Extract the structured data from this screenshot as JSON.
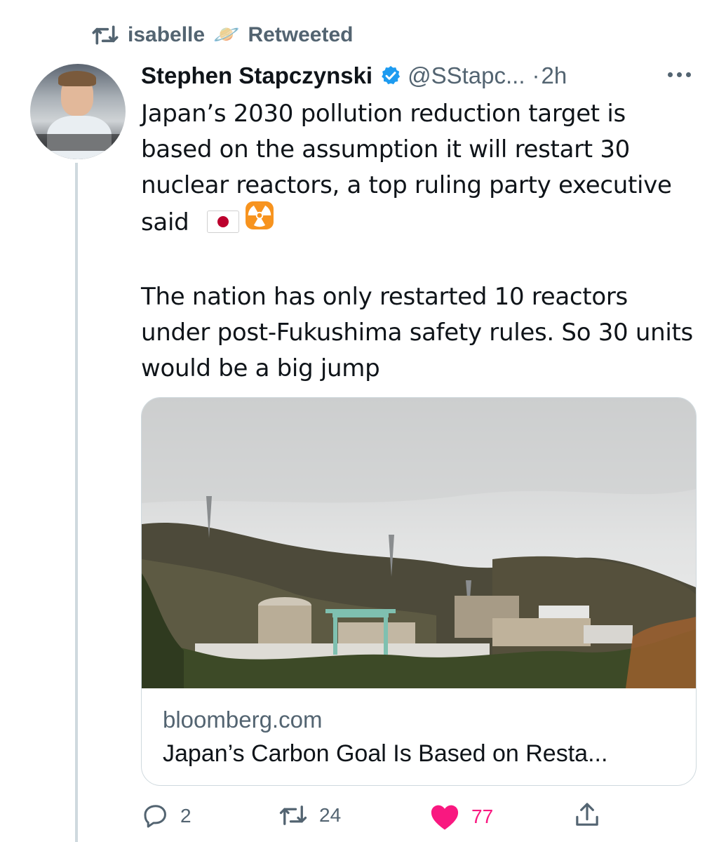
{
  "retweet_banner": {
    "user": "isabelle",
    "user_emoji": "🪐",
    "label": "Retweeted"
  },
  "tweet": {
    "author_name": "Stephen Stapczynski",
    "handle": "@SStapc...",
    "separator": "·",
    "time": "2h",
    "paragraph_1": "Japan’s 2030 pollution reduction target is based on the assumption it will restart 30 nuclear reactors, a top ruling party executive said",
    "paragraph_2": "The nation has only restarted 10 reactors under post-Fukushima safety rules. So 30 units would be a big jump"
  },
  "link_card": {
    "domain": "bloomberg.com",
    "title": "Japan’s Carbon Goal Is Based on Resta..."
  },
  "actions": {
    "reply_count": "2",
    "retweet_count": "24",
    "like_count": "77"
  },
  "colors": {
    "secondary_text": "#536471",
    "like_active": "#f91880",
    "verified_blue": "#1d9bf0",
    "border": "#cfd9de"
  },
  "icons": {
    "retweet_banner": "retweet-icon",
    "verified": "verified-badge-icon",
    "more": "more-dots-icon",
    "flag": "japan-flag-icon",
    "radioactive": "radioactive-icon",
    "reply": "reply-icon",
    "retweet": "retweet-icon",
    "like": "heart-icon",
    "share": "share-icon"
  }
}
